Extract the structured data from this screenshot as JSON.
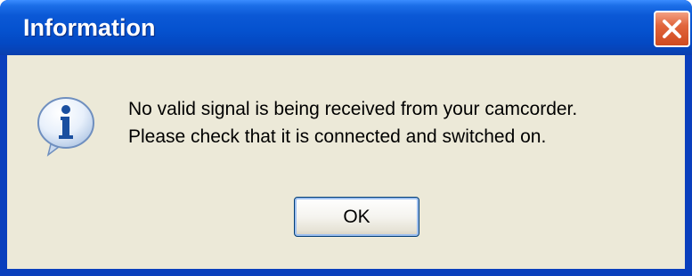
{
  "dialog": {
    "title": "Information",
    "icon": "information-icon",
    "message_line1": "No valid signal is being received from your camcorder.",
    "message_line2": "Please check that it is connected and switched on.",
    "ok_label": "OK"
  },
  "colors": {
    "titlebar": "#0552cf",
    "client_bg": "#ece9d8",
    "close_button": "#e1653c",
    "button_border": "#003c74"
  }
}
